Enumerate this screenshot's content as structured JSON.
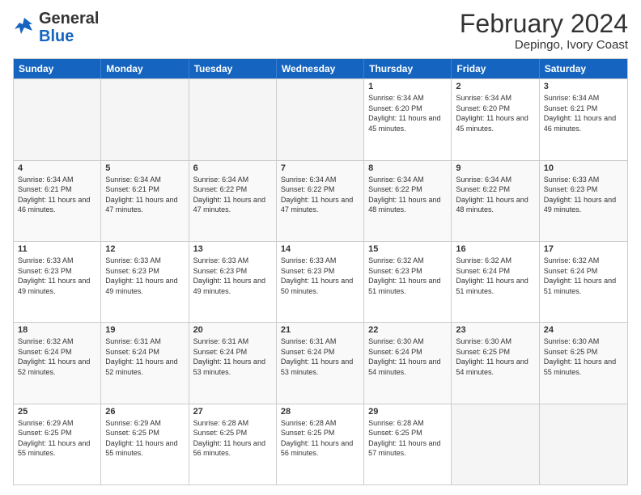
{
  "header": {
    "month_title": "February 2024",
    "location": "Depingo, Ivory Coast",
    "logo_line1": "General",
    "logo_line2": "Blue"
  },
  "days_of_week": [
    "Sunday",
    "Monday",
    "Tuesday",
    "Wednesday",
    "Thursday",
    "Friday",
    "Saturday"
  ],
  "rows": [
    [
      {
        "day": "",
        "sunrise": "",
        "sunset": "",
        "daylight": "",
        "empty": true
      },
      {
        "day": "",
        "sunrise": "",
        "sunset": "",
        "daylight": "",
        "empty": true
      },
      {
        "day": "",
        "sunrise": "",
        "sunset": "",
        "daylight": "",
        "empty": true
      },
      {
        "day": "",
        "sunrise": "",
        "sunset": "",
        "daylight": "",
        "empty": true
      },
      {
        "day": "1",
        "sunrise": "6:34 AM",
        "sunset": "6:20 PM",
        "daylight": "11 hours and 45 minutes.",
        "empty": false
      },
      {
        "day": "2",
        "sunrise": "6:34 AM",
        "sunset": "6:20 PM",
        "daylight": "11 hours and 45 minutes.",
        "empty": false
      },
      {
        "day": "3",
        "sunrise": "6:34 AM",
        "sunset": "6:21 PM",
        "daylight": "11 hours and 46 minutes.",
        "empty": false
      }
    ],
    [
      {
        "day": "4",
        "sunrise": "6:34 AM",
        "sunset": "6:21 PM",
        "daylight": "11 hours and 46 minutes.",
        "empty": false
      },
      {
        "day": "5",
        "sunrise": "6:34 AM",
        "sunset": "6:21 PM",
        "daylight": "11 hours and 47 minutes.",
        "empty": false
      },
      {
        "day": "6",
        "sunrise": "6:34 AM",
        "sunset": "6:22 PM",
        "daylight": "11 hours and 47 minutes.",
        "empty": false
      },
      {
        "day": "7",
        "sunrise": "6:34 AM",
        "sunset": "6:22 PM",
        "daylight": "11 hours and 47 minutes.",
        "empty": false
      },
      {
        "day": "8",
        "sunrise": "6:34 AM",
        "sunset": "6:22 PM",
        "daylight": "11 hours and 48 minutes.",
        "empty": false
      },
      {
        "day": "9",
        "sunrise": "6:34 AM",
        "sunset": "6:22 PM",
        "daylight": "11 hours and 48 minutes.",
        "empty": false
      },
      {
        "day": "10",
        "sunrise": "6:33 AM",
        "sunset": "6:23 PM",
        "daylight": "11 hours and 49 minutes.",
        "empty": false
      }
    ],
    [
      {
        "day": "11",
        "sunrise": "6:33 AM",
        "sunset": "6:23 PM",
        "daylight": "11 hours and 49 minutes.",
        "empty": false
      },
      {
        "day": "12",
        "sunrise": "6:33 AM",
        "sunset": "6:23 PM",
        "daylight": "11 hours and 49 minutes.",
        "empty": false
      },
      {
        "day": "13",
        "sunrise": "6:33 AM",
        "sunset": "6:23 PM",
        "daylight": "11 hours and 49 minutes.",
        "empty": false
      },
      {
        "day": "14",
        "sunrise": "6:33 AM",
        "sunset": "6:23 PM",
        "daylight": "11 hours and 50 minutes.",
        "empty": false
      },
      {
        "day": "15",
        "sunrise": "6:32 AM",
        "sunset": "6:23 PM",
        "daylight": "11 hours and 51 minutes.",
        "empty": false
      },
      {
        "day": "16",
        "sunrise": "6:32 AM",
        "sunset": "6:24 PM",
        "daylight": "11 hours and 51 minutes.",
        "empty": false
      },
      {
        "day": "17",
        "sunrise": "6:32 AM",
        "sunset": "6:24 PM",
        "daylight": "11 hours and 51 minutes.",
        "empty": false
      }
    ],
    [
      {
        "day": "18",
        "sunrise": "6:32 AM",
        "sunset": "6:24 PM",
        "daylight": "11 hours and 52 minutes.",
        "empty": false
      },
      {
        "day": "19",
        "sunrise": "6:31 AM",
        "sunset": "6:24 PM",
        "daylight": "11 hours and 52 minutes.",
        "empty": false
      },
      {
        "day": "20",
        "sunrise": "6:31 AM",
        "sunset": "6:24 PM",
        "daylight": "11 hours and 53 minutes.",
        "empty": false
      },
      {
        "day": "21",
        "sunrise": "6:31 AM",
        "sunset": "6:24 PM",
        "daylight": "11 hours and 53 minutes.",
        "empty": false
      },
      {
        "day": "22",
        "sunrise": "6:30 AM",
        "sunset": "6:24 PM",
        "daylight": "11 hours and 54 minutes.",
        "empty": false
      },
      {
        "day": "23",
        "sunrise": "6:30 AM",
        "sunset": "6:25 PM",
        "daylight": "11 hours and 54 minutes.",
        "empty": false
      },
      {
        "day": "24",
        "sunrise": "6:30 AM",
        "sunset": "6:25 PM",
        "daylight": "11 hours and 55 minutes.",
        "empty": false
      }
    ],
    [
      {
        "day": "25",
        "sunrise": "6:29 AM",
        "sunset": "6:25 PM",
        "daylight": "11 hours and 55 minutes.",
        "empty": false
      },
      {
        "day": "26",
        "sunrise": "6:29 AM",
        "sunset": "6:25 PM",
        "daylight": "11 hours and 55 minutes.",
        "empty": false
      },
      {
        "day": "27",
        "sunrise": "6:28 AM",
        "sunset": "6:25 PM",
        "daylight": "11 hours and 56 minutes.",
        "empty": false
      },
      {
        "day": "28",
        "sunrise": "6:28 AM",
        "sunset": "6:25 PM",
        "daylight": "11 hours and 56 minutes.",
        "empty": false
      },
      {
        "day": "29",
        "sunrise": "6:28 AM",
        "sunset": "6:25 PM",
        "daylight": "11 hours and 57 minutes.",
        "empty": false
      },
      {
        "day": "",
        "sunrise": "",
        "sunset": "",
        "daylight": "",
        "empty": true
      },
      {
        "day": "",
        "sunrise": "",
        "sunset": "",
        "daylight": "",
        "empty": true
      }
    ]
  ]
}
